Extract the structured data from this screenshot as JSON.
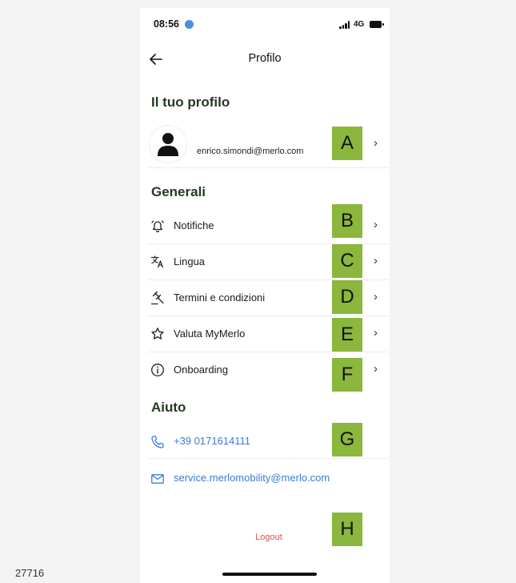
{
  "status_bar": {
    "time": "08:56",
    "network": "4G"
  },
  "nav": {
    "title": "Profilo",
    "back_icon": "arrow-left-icon"
  },
  "profile_section": {
    "title": "Il tuo profilo",
    "email": "enrico.simondi@merlo.com",
    "avatar_icon": "user-icon"
  },
  "general_section": {
    "title": "Generali",
    "items": [
      {
        "label": "Notifiche",
        "icon": "bell-icon"
      },
      {
        "label": "Lingua",
        "icon": "translate-icon"
      },
      {
        "label": "Termini e condizioni",
        "icon": "gavel-icon"
      },
      {
        "label": "Valuta MyMerlo",
        "icon": "star-icon"
      },
      {
        "label": "Onboarding",
        "icon": "info-icon"
      }
    ]
  },
  "help_section": {
    "title": "Aiuto",
    "phone": "+39 0171614111",
    "email": "service.merlomobility@merlo.com"
  },
  "logout_label": "Logout",
  "annotation_badges": [
    "A",
    "B",
    "C",
    "D",
    "E",
    "F",
    "G",
    "H"
  ],
  "doc_id": "27716",
  "colors": {
    "section_title": "#233a23",
    "link": "#3b7bd4",
    "logout": "#d9534f",
    "badge": "#8ab73c"
  }
}
